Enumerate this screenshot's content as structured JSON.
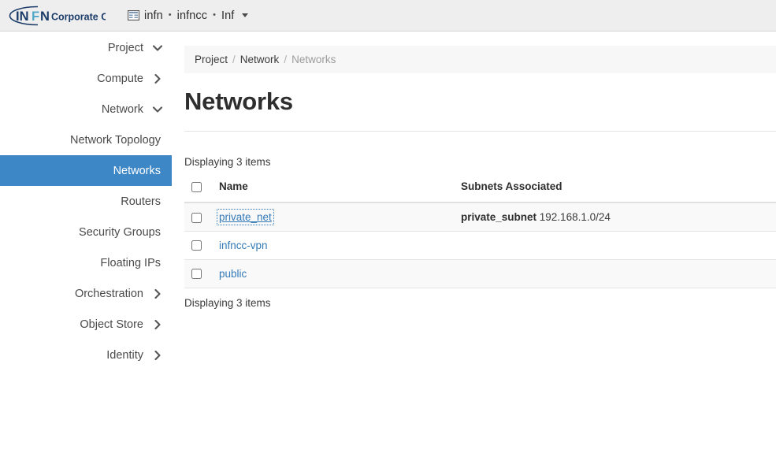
{
  "topbar": {
    "brand": {
      "name": "INFN Corporate Cloud",
      "part_in": "IN",
      "part_f": "F",
      "part_n": "N",
      "tagline": "Corporate Cloud"
    },
    "context_switcher": {
      "icon": "grid-icon",
      "project": "infn",
      "domain": "infncc",
      "user": "Inf",
      "separator": "•",
      "caret": "chevron-down-icon"
    }
  },
  "sidebar": {
    "items": [
      {
        "label": "Project",
        "level": 1,
        "chevron": "down",
        "active": false
      },
      {
        "label": "Compute",
        "level": 2,
        "chevron": "right",
        "active": false
      },
      {
        "label": "Network",
        "level": 2,
        "chevron": "down",
        "active": false
      },
      {
        "label": "Network Topology",
        "level": 3,
        "chevron": "none",
        "active": false
      },
      {
        "label": "Networks",
        "level": 3,
        "chevron": "none",
        "active": true
      },
      {
        "label": "Routers",
        "level": 3,
        "chevron": "none",
        "active": false
      },
      {
        "label": "Security Groups",
        "level": 3,
        "chevron": "none",
        "active": false
      },
      {
        "label": "Floating IPs",
        "level": 3,
        "chevron": "none",
        "active": false
      },
      {
        "label": "Orchestration",
        "level": 2,
        "chevron": "right",
        "active": false
      },
      {
        "label": "Object Store",
        "level": 2,
        "chevron": "right",
        "active": false
      },
      {
        "label": "Identity",
        "level": 1,
        "chevron": "right",
        "active": false
      }
    ]
  },
  "main": {
    "breadcrumb": [
      {
        "label": "Project",
        "current": false
      },
      {
        "label": "Network",
        "current": false
      },
      {
        "label": "Networks",
        "current": true
      }
    ],
    "breadcrumb_separator": "/",
    "page_title": "Networks",
    "count_top": "Displaying 3 items",
    "count_bottom": "Displaying 3 items",
    "table": {
      "columns": [
        "",
        "Name",
        "Subnets Associated"
      ],
      "header_select_all_checkbox": false,
      "rows": [
        {
          "selected": false,
          "name": "private_net",
          "focused": true,
          "subnet_name": "private_subnet",
          "subnet_cidr": "192.168.1.0/24"
        },
        {
          "selected": false,
          "name": "infncc-vpn",
          "focused": false,
          "subnet_name": "",
          "subnet_cidr": ""
        },
        {
          "selected": false,
          "name": "public",
          "focused": false,
          "subnet_name": "",
          "subnet_cidr": ""
        }
      ]
    }
  },
  "colors": {
    "accent_blue": "#3e87c6",
    "link_blue": "#337ab7",
    "navbar_bg": "#eeeeee",
    "breadcrumb_bg": "#f7f7f7",
    "row_shaded": "#f9f9f9",
    "logo_dark": "#1b3c68",
    "logo_light": "#4aa6c4"
  }
}
